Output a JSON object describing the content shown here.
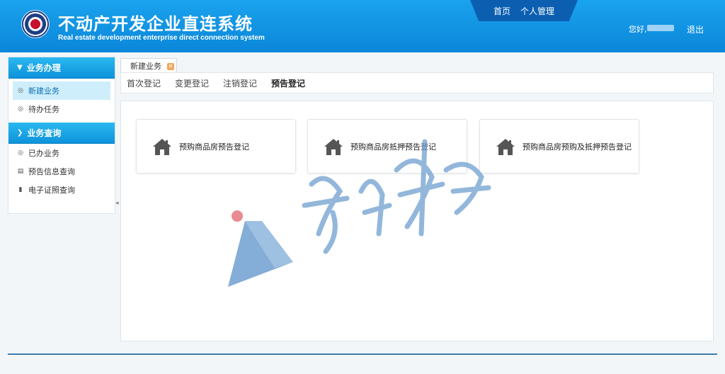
{
  "header": {
    "title_cn": "不动产开发企业直连系统",
    "title_en": "Real estate development enterprise direct connection system",
    "nav": [
      "首页",
      "个人管理"
    ],
    "greeting": "您好,",
    "logout": "退出"
  },
  "sidebar": {
    "sections": [
      {
        "title": "业务办理",
        "icon": "chevron-down-icon",
        "items": [
          {
            "label": "新建业务",
            "icon": "circle-bullet-icon",
            "active": true
          },
          {
            "label": "待办任务",
            "icon": "circle-bullet-icon",
            "active": false
          }
        ]
      },
      {
        "title": "业务查询",
        "icon": "chevron-right-icon",
        "items": [
          {
            "label": "已办业务",
            "icon": "circle-bullet-icon"
          },
          {
            "label": "预告信息查询",
            "icon": "document-icon"
          },
          {
            "label": "电子证照查询",
            "icon": "document-icon"
          }
        ]
      }
    ]
  },
  "tabs": {
    "active_tab": "新建业务"
  },
  "subnav": {
    "items": [
      "首次登记",
      "变更登记",
      "注销登记",
      "预告登记"
    ],
    "selected": "预告登记"
  },
  "cards": [
    {
      "label": "预购商品房预告登记",
      "icon": "house-icon"
    },
    {
      "label": "预购商品房抵押预告登记",
      "icon": "house-icon"
    },
    {
      "label": "预购商品房预购及抵押预告登记",
      "icon": "house-icon"
    }
  ],
  "colors": {
    "header": "#0b86d9",
    "sidebar_head": "#1aa7e8",
    "active_item": "#cfeefb",
    "watermark": "#6f9fd0"
  }
}
